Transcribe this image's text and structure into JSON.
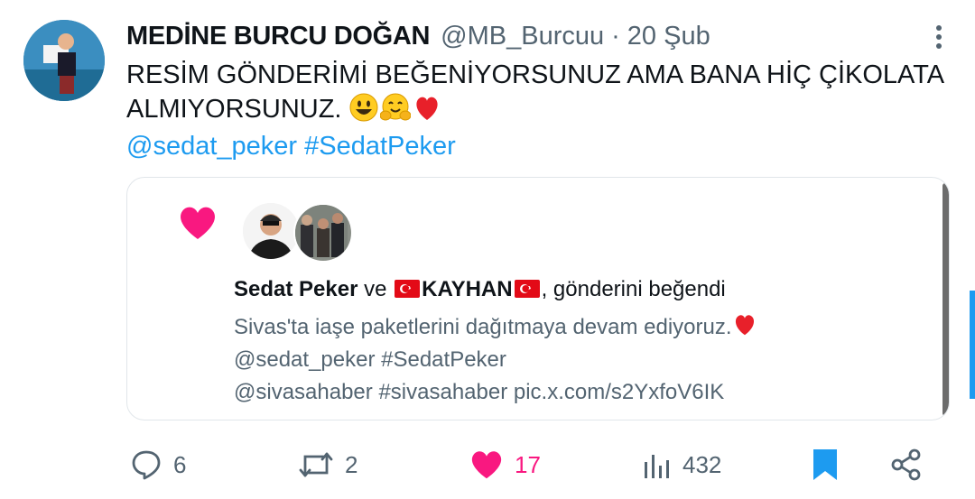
{
  "tweet": {
    "author_name": "MEDİNE BURCU DOĞAN",
    "handle": "@MB_Burcuu",
    "separator": "·",
    "date": "20 Şub",
    "text_line1": "RESİM GÖNDERİMİ BEĞENİYORSUNUZ AMA BANA HİÇ ÇİKOLATA",
    "text_line2": "ALMIYORSUNUZ.",
    "mention": "@sedat_peker",
    "hashtag": "#SedatPeker",
    "emojis": [
      "smiley-emoji",
      "hugging-emoji",
      "red-heart-emoji"
    ]
  },
  "card": {
    "liker1": "Sedat Peker",
    "connector": "ve",
    "liker2": "KAYHAN",
    "liked_suffix": ", gönderini beğendi",
    "quoted_line1": "Sivas'ta iaşe paketlerini dağıtmaya devam ediyoruz.",
    "quoted_line2": "@sedat_peker #SedatPeker",
    "quoted_line3": "@sivasahaber #sivasahaber pic.x.com/s2YxfoV6IK"
  },
  "actions": {
    "replies": "6",
    "retweets": "2",
    "likes": "17",
    "views": "432"
  },
  "colors": {
    "link": "#1d9bf0",
    "like": "#f91880",
    "muted": "#536471",
    "text": "#0f1419"
  }
}
